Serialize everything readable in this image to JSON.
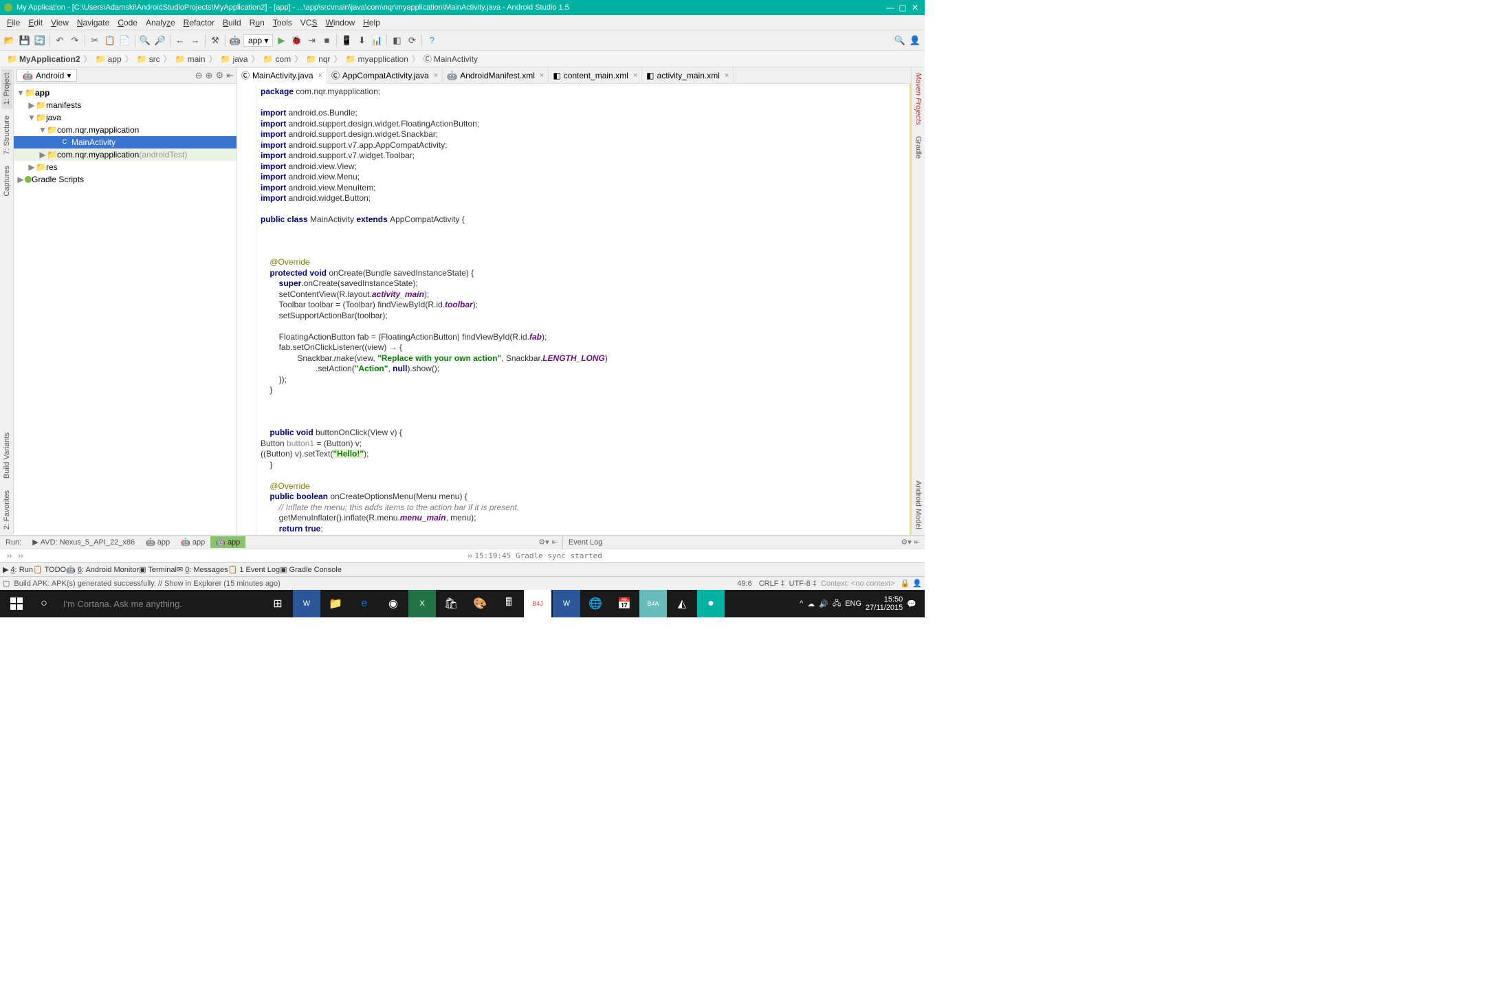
{
  "title": "My Application - [C:\\Users\\Adamski\\AndroidStudioProjects\\MyApplication2] - [app] - ...\\app\\src\\main\\java\\com\\nqr\\myapplication\\MainActivity.java - Android Studio 1.5",
  "menu": [
    "File",
    "Edit",
    "View",
    "Navigate",
    "Code",
    "Analyze",
    "Refactor",
    "Build",
    "Run",
    "Tools",
    "VCS",
    "Window",
    "Help"
  ],
  "run_target": "app",
  "breadcrumbs": [
    "MyApplication2",
    "app",
    "src",
    "main",
    "java",
    "com",
    "nqr",
    "myapplication",
    "MainActivity"
  ],
  "project_view": "Android",
  "left_tools": [
    "1: Project",
    "7: Structure",
    "Captures",
    "Build Variants",
    "2: Favorites"
  ],
  "right_tools": [
    "Maven Projects",
    "Gradle",
    "Android Model"
  ],
  "tree": {
    "root": "app",
    "items": [
      "manifests",
      "java",
      "com.nqr.myapplication",
      "MainActivity",
      "com.nqr.myapplication",
      "(androidTest)",
      "res",
      "Gradle Scripts"
    ]
  },
  "tabs": [
    {
      "label": "MainActivity.java",
      "active": true
    },
    {
      "label": "AppCompatActivity.java",
      "active": false
    },
    {
      "label": "AndroidManifest.xml",
      "active": false
    },
    {
      "label": "content_main.xml",
      "active": false
    },
    {
      "label": "activity_main.xml",
      "active": false
    }
  ],
  "code": {
    "package": "package ",
    "pkgname": "com.nqr.myapplication;",
    "imports": [
      "android.os.Bundle;",
      "android.support.design.widget.FloatingActionButton;",
      "android.support.design.widget.Snackbar;",
      "android.support.v7.app.AppCompatActivity;",
      "android.support.v7.widget.Toolbar;",
      "android.view.View;",
      "android.view.Menu;",
      "android.view.MenuItem;",
      "android.widget.Button;"
    ],
    "classdecl1": "public class ",
    "classname": "MainActivity ",
    "classdecl2": "extends ",
    "superclass": "AppCompatActivity {",
    "override": "@Override",
    "oncreate": "    protected void ",
    "oncreate2": "onCreate(Bundle savedInstanceState) {",
    "super": "        super",
    "super2": ".onCreate(savedInstanceState);",
    "setcv": "        setContentView(R.layout.",
    "actmain": "activity_main",
    "setcv2": ");",
    "tbar": "        Toolbar toolbar = (Toolbar) findViewById(R.id.",
    "tbarfld": "toolbar",
    "tbar2": ");",
    "ssab": "        setSupportActionBar(toolbar);",
    "fab": "        FloatingActionButton fab = (FloatingActionButton) findViewById(R.id.",
    "fabfld": "fab",
    "fab2": ");",
    "fabl": "        fab.setOnClickListener((view) → {",
    "snack": "                Snackbar.",
    "make": "make",
    "snack2": "(view, ",
    "snackstr": "\"Replace with your own action\"",
    "snack3": ", Snackbar.",
    "lenlong": "LENGTH_LONG",
    "snack4": ")",
    "seta": "                        .setAction(",
    "actstr": "\"Action\"",
    "seta2": ", ",
    "null": "null",
    "seta3": ").show();",
    "close1": "        });",
    "close2": "    }",
    "bclick": "    public void ",
    "bclick2": "buttonOnClick(View v) {",
    "bline": "Button ",
    "bvar": "button1",
    "bline2": " = (Button) v;",
    "bset": "((Button) v).setText(",
    "hello": "\"Hello!\"",
    "bset2": ");",
    "close3": "    }",
    "ocmenu": "    public boolean ",
    "ocmenu2": "onCreateOptionsMenu(Menu menu) {",
    "cmt": "        // Inflate the menu; this adds items to the action bar if it is present.",
    "gmi": "        getMenuInflater().inflate(R.menu.",
    "menumain": "menu_main",
    "gmi2": ", menu);",
    "rettrue": "        return true",
    "close4": "    }"
  },
  "run_tabs": {
    "label": "Run:",
    "avd": "AVD: Nexus_5_API_22_x86",
    "apps": [
      "app",
      "app",
      "app"
    ]
  },
  "event_log_label": "Event Log",
  "event_log_msg": "15:19:45 Gradle sync started",
  "bottom_tabs": [
    "4: Run",
    "TODO",
    "6: Android Monitor",
    "Terminal",
    "0: Messages"
  ],
  "bottom_right": [
    "1 Event Log",
    "Gradle Console"
  ],
  "status": {
    "msg": "Build APK: APK(s) generated successfully. // Show in Explorer (15 minutes ago)",
    "pos": "49:6",
    "eol": "CRLF ‡",
    "enc": "UTF-8 ‡",
    "ctx": "Context: <no context>"
  },
  "taskbar": {
    "search": "I'm Cortana. Ask me anything.",
    "lang": "ENG",
    "time": "15:50",
    "date": "27/11/2015"
  }
}
